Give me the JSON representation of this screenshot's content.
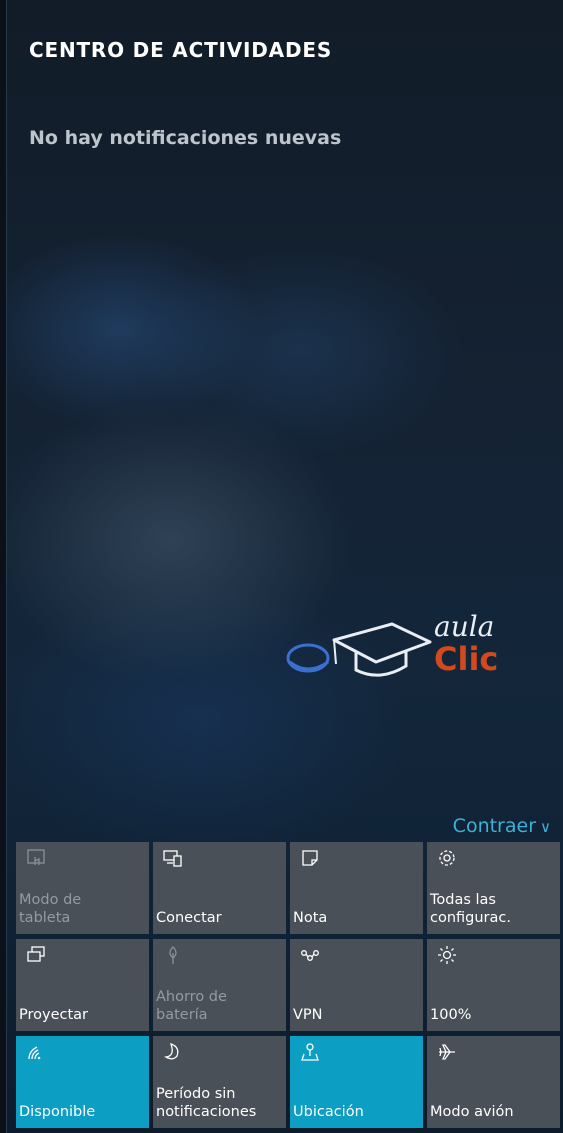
{
  "header": {
    "title": "CENTRO DE ACTIVIDADES"
  },
  "notifications": {
    "empty_text": "No hay notificaciones nuevas"
  },
  "watermark": {
    "line1": "aula",
    "line2": "Clic"
  },
  "collapse": {
    "label": "Contraer",
    "chevron": "∨"
  },
  "colors": {
    "tile_default": "#4a5057",
    "tile_active": "#0d9ec3",
    "accent_link": "#3fb0d8",
    "logo_orange": "#d2491e"
  },
  "quick_actions": [
    {
      "icon": "tablet-mode-icon",
      "label": "Modo de\ntableta",
      "state": "disabled"
    },
    {
      "icon": "connect-icon",
      "label": "Conectar",
      "state": "off"
    },
    {
      "icon": "note-icon",
      "label": "Nota",
      "state": "off"
    },
    {
      "icon": "settings-gear-icon",
      "label": "Todas las\nconfigurac.",
      "state": "off"
    },
    {
      "icon": "project-icon",
      "label": "Proyectar",
      "state": "off"
    },
    {
      "icon": "battery-saver-icon",
      "label": "Ahorro de\nbatería",
      "state": "disabled"
    },
    {
      "icon": "vpn-icon",
      "label": "VPN",
      "state": "off"
    },
    {
      "icon": "brightness-icon",
      "label": "100%",
      "state": "off"
    },
    {
      "icon": "wifi-icon",
      "label": "Disponible",
      "state": "active"
    },
    {
      "icon": "quiet-hours-moon-icon",
      "label": "Período sin\nnotificaciones",
      "state": "off"
    },
    {
      "icon": "location-icon",
      "label": "Ubicación",
      "state": "active"
    },
    {
      "icon": "airplane-icon",
      "label": "Modo avión",
      "state": "off"
    }
  ]
}
